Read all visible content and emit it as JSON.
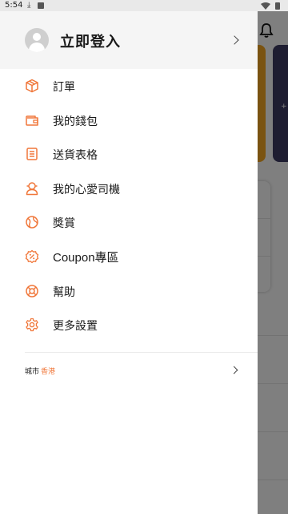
{
  "status_bar": {
    "time": "5:54",
    "download_glyph": "⤓",
    "icons": [
      "download-icon",
      "sim-icon",
      "wifi-icon",
      "battery-icon"
    ]
  },
  "colors": {
    "accent": "#f0773a",
    "header_bg": "#f5f5f5",
    "scrim": "rgba(0,0,0,0.5)",
    "bg_card_orange": "#f5a623",
    "bg_card_purple": "#3d3a63"
  },
  "drawer": {
    "header": {
      "login_label": "立即登入",
      "avatar_icon": "user-avatar-icon",
      "chevron_icon": "chevron-right-icon"
    },
    "menu": [
      {
        "label": "訂單",
        "icon": "box-icon"
      },
      {
        "label": "我的錢包",
        "icon": "wallet-icon"
      },
      {
        "label": "送貨表格",
        "icon": "clipboard-icon"
      },
      {
        "label": "我的心愛司機",
        "icon": "driver-icon"
      },
      {
        "label": "獎賞",
        "icon": "globe-icon"
      },
      {
        "label": "Coupon專區",
        "icon": "coupon-icon"
      },
      {
        "label": "幫助",
        "icon": "lifebuoy-icon"
      },
      {
        "label": "更多設置",
        "icon": "gear-icon"
      }
    ],
    "city": {
      "label": "城市",
      "value": "香港"
    }
  },
  "background": {
    "card_text": "+"
  }
}
